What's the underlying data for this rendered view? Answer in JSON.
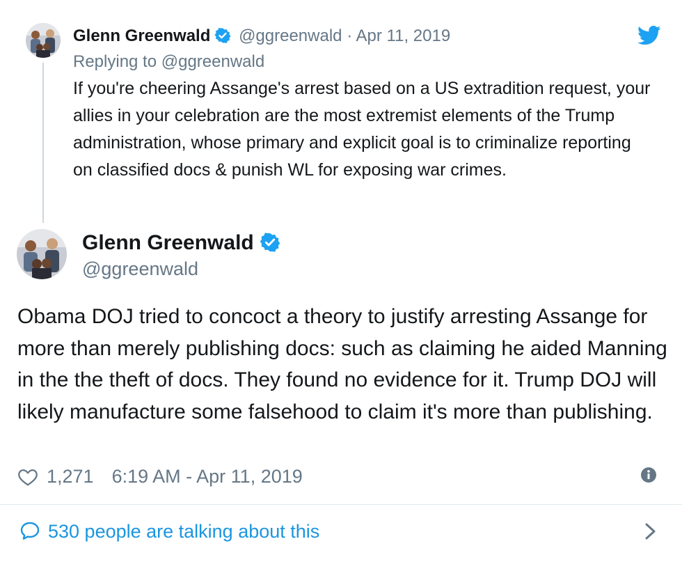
{
  "parent_tweet": {
    "name": "Glenn Greenwald",
    "handle": "@ggreenwald",
    "separator": "·",
    "date": "Apr 11, 2019",
    "replying_to": "Replying to @ggreenwald",
    "text": "If you're cheering Assange's arrest based on a US extradition request, your allies in your celebration are the most extremist elements of the Trump administration, whose primary and explicit goal is to criminalize reporting on classified docs & punish WL for exposing war crimes."
  },
  "main_tweet": {
    "name": "Glenn Greenwald",
    "handle": "@ggreenwald",
    "text": "Obama DOJ tried to concoct a theory to justify arresting Assange for more than merely publishing docs: such as claiming he aided Manning in the the theft of docs. They found no evidence for it. Trump DOJ will likely manufacture some falsehood to claim it's more than publishing.",
    "likes": "1,271",
    "timestamp": "6:19 AM - Apr 11, 2019"
  },
  "conversation": {
    "label": "530 people are talking about this"
  },
  "icons": {
    "brand": "twitter-bird-icon",
    "verified": "verified-badge-icon",
    "like": "heart-icon",
    "info": "info-icon",
    "reply": "speech-bubble-icon",
    "chevron": "chevron-right-icon"
  },
  "colors": {
    "accent": "#1da1f2",
    "link": "#1b95e0",
    "text": "#14171a",
    "muted": "#657786",
    "divider": "#e1e8ed"
  }
}
